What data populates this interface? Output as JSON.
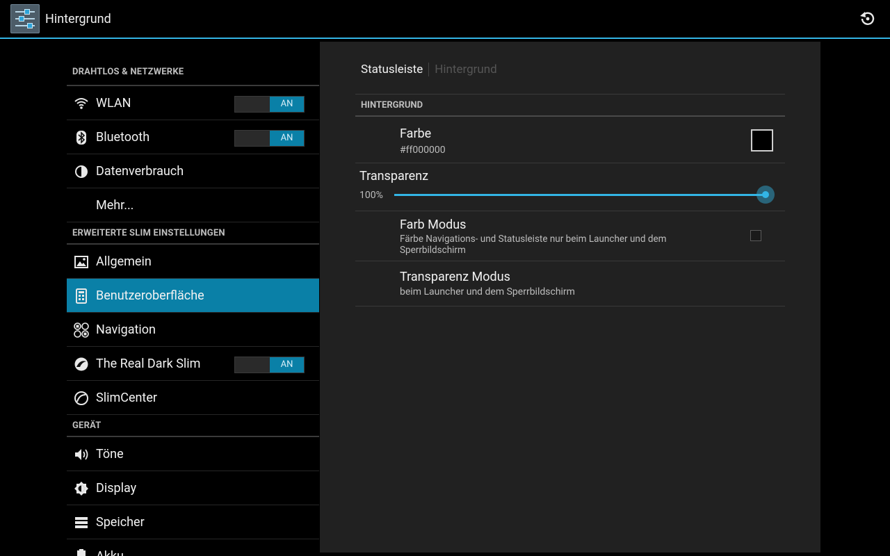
{
  "app": {
    "title": "Hintergrund"
  },
  "sidebar": {
    "sections": [
      {
        "header": "DRAHTLOS & NETZWERKE",
        "items": [
          {
            "label": "WLAN",
            "icon": "wifi-icon",
            "toggle": "AN"
          },
          {
            "label": "Bluetooth",
            "icon": "bluetooth-icon",
            "toggle": "AN"
          },
          {
            "label": "Datenverbrauch",
            "icon": "data-usage-icon"
          },
          {
            "label": "Mehr..."
          }
        ]
      },
      {
        "header": "ERWEITERTE SLIM EINSTELLUNGEN",
        "items": [
          {
            "label": "Allgemein",
            "icon": "image-icon"
          },
          {
            "label": "Benutzeroberfläche",
            "icon": "ui-icon",
            "selected": true
          },
          {
            "label": "Navigation",
            "icon": "navigation-icon"
          },
          {
            "label": "The Real Dark Slim",
            "icon": "slim-dark-icon",
            "toggle": "AN"
          },
          {
            "label": "SlimCenter",
            "icon": "slimcenter-icon"
          }
        ]
      },
      {
        "header": "GERÄT",
        "items": [
          {
            "label": "Töne",
            "icon": "sound-icon"
          },
          {
            "label": "Display",
            "icon": "display-icon"
          },
          {
            "label": "Speicher",
            "icon": "storage-icon"
          },
          {
            "label": "Akku",
            "icon": "battery-icon"
          }
        ]
      }
    ]
  },
  "tabs": {
    "active": "Statusleiste",
    "inactive": "Hintergrund"
  },
  "prefs": {
    "section": "HINTERGRUND",
    "farbe": {
      "title": "Farbe",
      "summary": "#ff000000",
      "color": "#000000"
    },
    "transparenz": {
      "title": "Transparenz",
      "value_label": "100%",
      "value": 1.0
    },
    "farb_modus": {
      "title": "Farb Modus",
      "summary": "Färbe Navigations- und Statusleiste nur beim Launcher und dem Sperrbildschirm",
      "checked": false
    },
    "transparenz_modus": {
      "title": "Transparenz Modus",
      "summary": "beim Launcher und dem Sperrbildschirm"
    }
  },
  "colors": {
    "accent": "#33b5e5",
    "selected": "#0a80a7"
  }
}
